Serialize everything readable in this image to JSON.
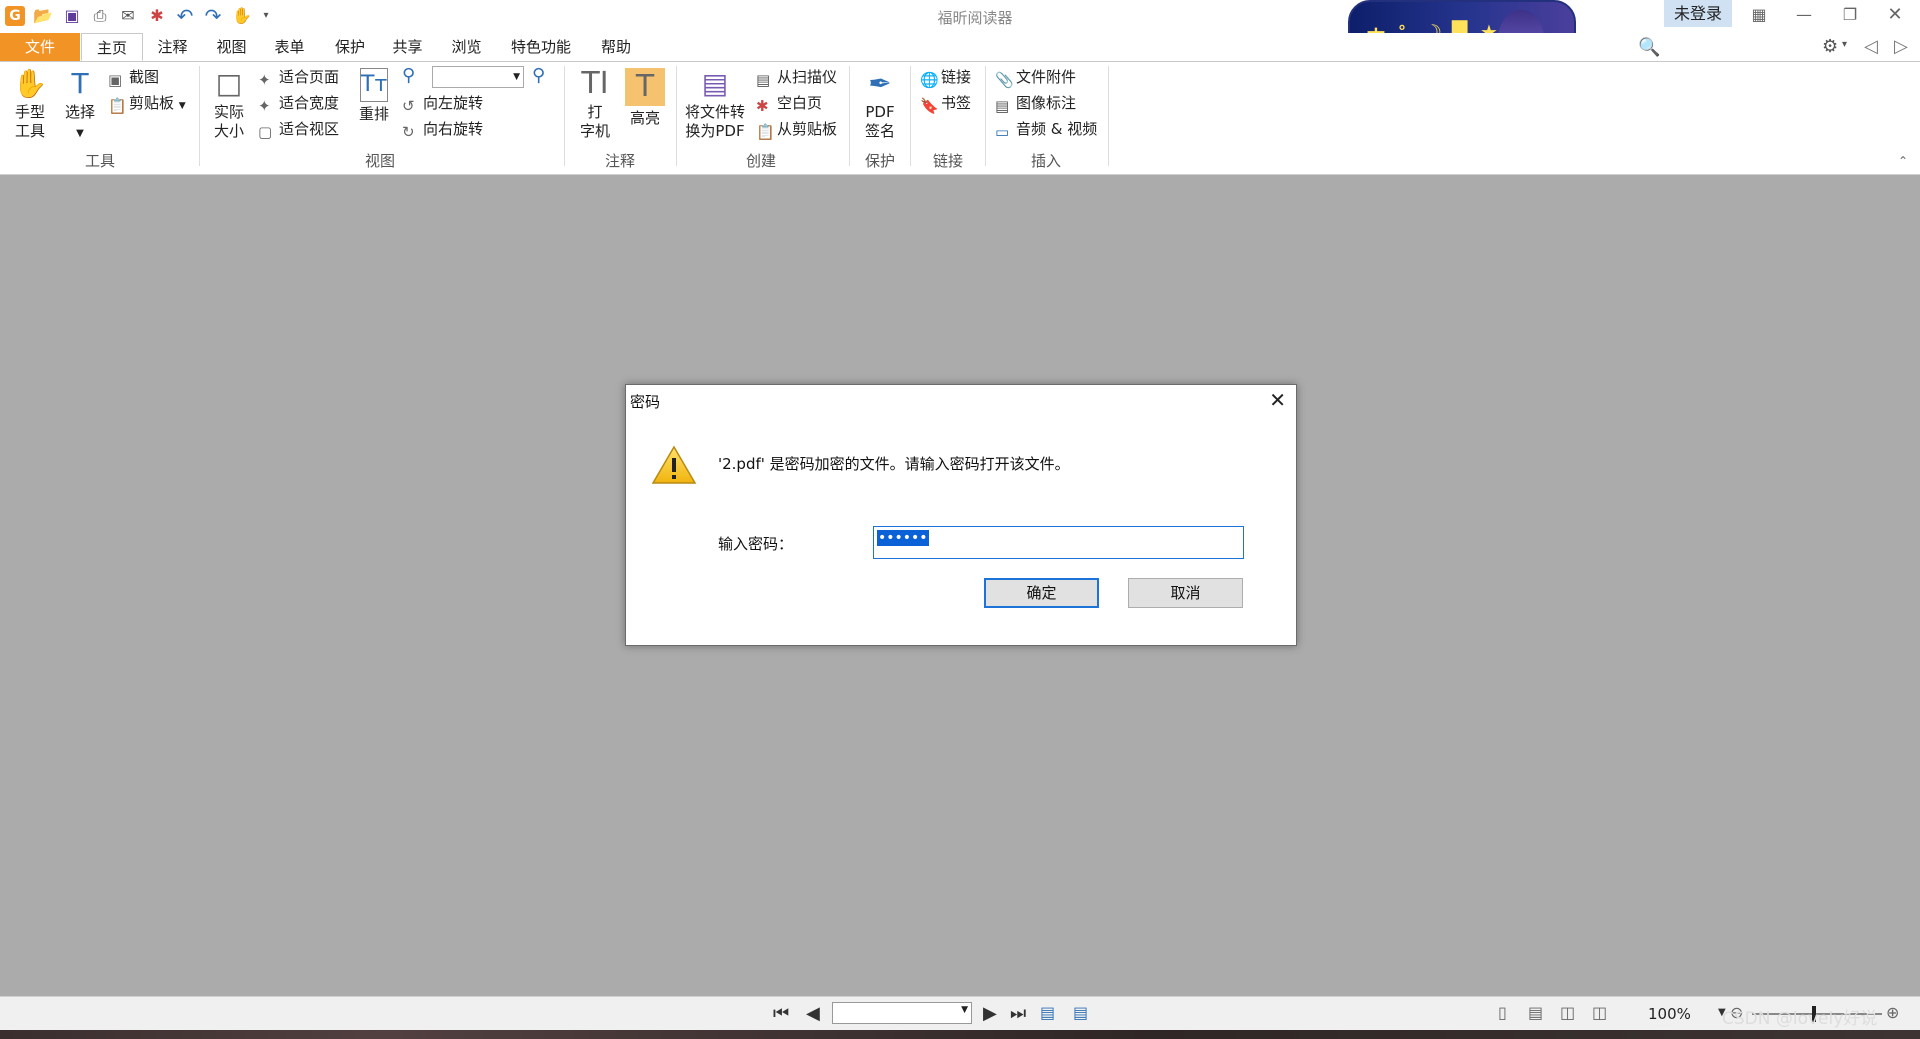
{
  "app": {
    "title": "福昕阅读器",
    "login_label": "未登录"
  },
  "menu": {
    "file": "文件",
    "tabs": [
      "主页",
      "注释",
      "视图",
      "表单",
      "保护",
      "共享",
      "浏览",
      "特色功能",
      "帮助"
    ]
  },
  "search": {
    "placeholder": "查找"
  },
  "ribbon": {
    "tools": {
      "hand": [
        "手型",
        "工具"
      ],
      "select": "选择",
      "screenshot": "截图",
      "clipboard": "剪贴板",
      "label": "工具"
    },
    "view": {
      "actual_size": [
        "实际",
        "大小"
      ],
      "fit_page": "适合页面",
      "fit_width": "适合宽度",
      "fit_visible": "适合视区",
      "reflow": "重排",
      "rotate_left": "向左旋转",
      "rotate_right": "向右旋转",
      "label": "视图"
    },
    "comment": {
      "typewriter": [
        "打",
        "字机"
      ],
      "highlight": "高亮",
      "label": "注释"
    },
    "create": {
      "convert": [
        "将文件转",
        "换为PDF"
      ],
      "from_scanner": "从扫描仪",
      "blank_page": "空白页",
      "from_clipboard": "从剪贴板",
      "label": "创建"
    },
    "protect": {
      "pdf_sign": [
        "PDF",
        "签名"
      ],
      "label": "保护"
    },
    "links": {
      "link": "链接",
      "bookmark": "书签",
      "label": "链接"
    },
    "insert": {
      "attachment": "文件附件",
      "image_annotation": "图像标注",
      "audio_video": "音频 & 视频",
      "label": "插入"
    }
  },
  "banner": {
    "text": "中"
  },
  "status": {
    "zoom": "100%",
    "watermark": "CSDN @lovely好说"
  },
  "dialog": {
    "title": "密码",
    "message": "'2.pdf' 是密码加密的文件。请输入密码打开该文件。",
    "password_label": "输入密码：",
    "password_value": "••••••",
    "ok_label": "确定",
    "cancel_label": "取消"
  }
}
